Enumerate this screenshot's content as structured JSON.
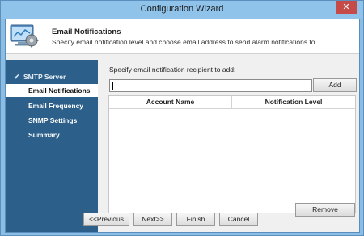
{
  "window": {
    "title": "Configuration Wizard",
    "close_glyph": "✕"
  },
  "header": {
    "title": "Email Notifications",
    "subtitle": "Specify email notification level and choose email address to send alarm notifications to.",
    "icon": "wizard-monitor-icon"
  },
  "sidebar": {
    "items": [
      {
        "label": "SMTP Server",
        "state": "completed",
        "check_glyph": "✔"
      },
      {
        "label": "Email Notifications",
        "state": "active"
      },
      {
        "label": "Email Frequency",
        "state": "pending"
      },
      {
        "label": "SNMP Settings",
        "state": "pending"
      },
      {
        "label": "Summary",
        "state": "pending"
      }
    ]
  },
  "main": {
    "prompt": "Specify email notification recipient to add:",
    "email_input": {
      "value": "",
      "placeholder": ""
    },
    "add_label": "Add",
    "table": {
      "columns": [
        "Account Name",
        "Notification Level"
      ],
      "rows": []
    },
    "remove_label": "Remove"
  },
  "footer": {
    "back_label": "<<Previous",
    "next_label": "Next>>",
    "finish_label": "Finish",
    "cancel_label": "Cancel"
  },
  "colors": {
    "sidebar": "#2c5f8a",
    "titlebar": "#8fc3ea",
    "close": "#c64a47"
  }
}
